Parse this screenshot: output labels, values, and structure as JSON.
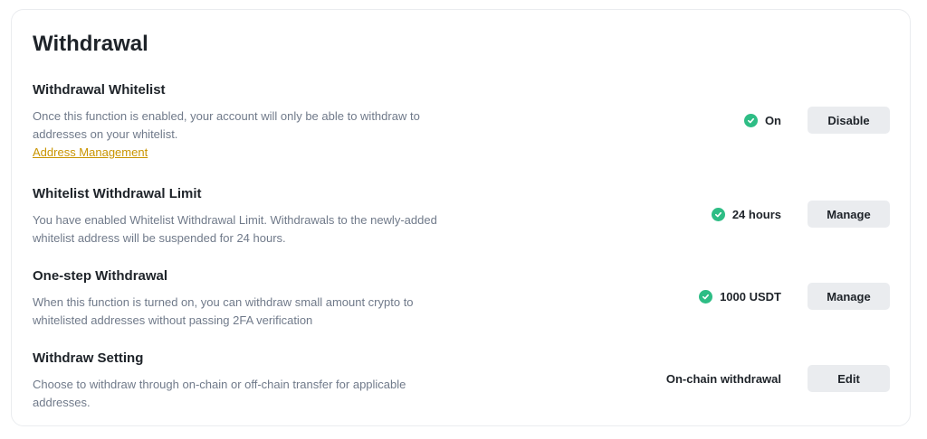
{
  "page": {
    "title": "Withdrawal"
  },
  "colors": {
    "accent_link": "#c99400",
    "status_check": "#2ebd85",
    "button_bg": "#eaecef"
  },
  "rows": [
    {
      "title": "Withdrawal Whitelist",
      "description": "Once this function is enabled, your account will only be able to withdraw to addresses on your whitelist.",
      "link": "Address Management",
      "status": "On",
      "status_icon": "check-circle-icon",
      "button": "Disable"
    },
    {
      "title": "Whitelist Withdrawal Limit",
      "description": "You have enabled Whitelist Withdrawal Limit. Withdrawals to the newly-added whitelist address will be suspended for 24 hours.",
      "status": "24 hours",
      "status_icon": "check-circle-icon",
      "button": "Manage"
    },
    {
      "title": "One-step Withdrawal",
      "description": "When this function is turned on, you can withdraw small amount crypto to whitelisted addresses without passing 2FA verification",
      "status": "1000 USDT",
      "status_icon": "check-circle-icon",
      "button": "Manage"
    },
    {
      "title": "Withdraw Setting",
      "description": "Choose to withdraw through on-chain or off-chain transfer for applicable addresses.",
      "status": "On-chain withdrawal",
      "button": "Edit"
    }
  ]
}
